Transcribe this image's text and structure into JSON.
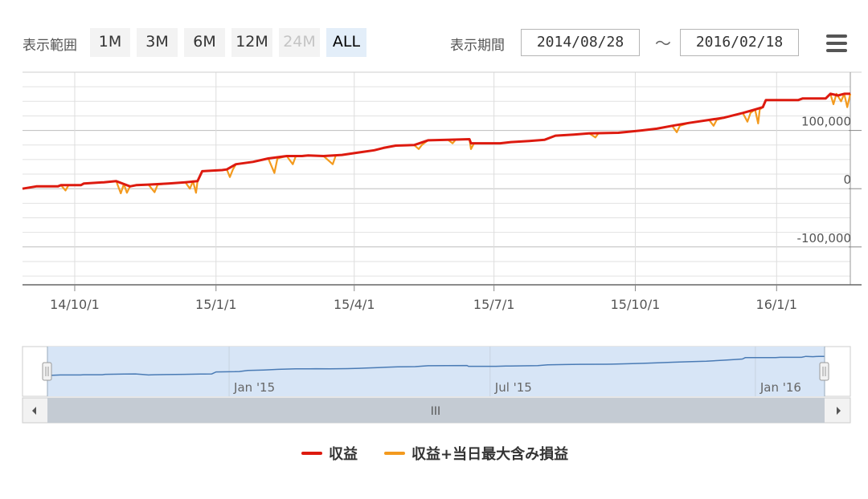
{
  "range_selector": {
    "label": "表示範囲",
    "buttons": [
      {
        "label": "1M",
        "state": "normal"
      },
      {
        "label": "3M",
        "state": "normal"
      },
      {
        "label": "6M",
        "state": "normal"
      },
      {
        "label": "12M",
        "state": "normal"
      },
      {
        "label": "24M",
        "state": "disabled"
      },
      {
        "label": "ALL",
        "state": "active"
      }
    ]
  },
  "period": {
    "label": "表示期間",
    "from": "2014/08/28",
    "separator": "〜",
    "to": "2016/02/18"
  },
  "menu_icon": "hamburger-menu-icon",
  "colors": {
    "profit_line": "#dd1a0f",
    "profit_max_line": "#f39a1e",
    "navigator_line": "#4a7bb5",
    "navigator_fill": "#d7e5f6",
    "grid": "#dddddd"
  },
  "chart_data": {
    "type": "line",
    "x_axis": {
      "type": "date",
      "range": [
        "2014-08-28",
        "2016-02-18"
      ],
      "tick_labels": [
        {
          "date": "2014-10-01",
          "label": "14/10/1"
        },
        {
          "date": "2015-01-01",
          "label": "15/1/1"
        },
        {
          "date": "2015-04-01",
          "label": "15/4/1"
        },
        {
          "date": "2015-07-01",
          "label": "15/7/1"
        },
        {
          "date": "2015-10-01",
          "label": "15/10/1"
        },
        {
          "date": "2016-01-01",
          "label": "16/1/1"
        }
      ]
    },
    "y_axis": {
      "range": [
        -165000,
        200000
      ],
      "position": "right",
      "tick_labels": [
        {
          "value": 100000,
          "label": "100,000"
        },
        {
          "value": 0,
          "label": "0"
        },
        {
          "value": -100000,
          "label": "-100,000"
        }
      ]
    },
    "grid": true,
    "legend_position": "bottom-center",
    "series": [
      {
        "name": "収益",
        "color": "#dd1a0f",
        "points": [
          [
            "2014-08-28",
            0
          ],
          [
            "2014-09-06",
            4000
          ],
          [
            "2014-09-20",
            4000
          ],
          [
            "2014-09-22",
            6000
          ],
          [
            "2014-10-05",
            6000
          ],
          [
            "2014-10-07",
            9000
          ],
          [
            "2014-10-20",
            11000
          ],
          [
            "2014-10-28",
            13000
          ],
          [
            "2014-11-02",
            8000
          ],
          [
            "2014-11-06",
            4000
          ],
          [
            "2014-11-10",
            6000
          ],
          [
            "2014-11-18",
            7000
          ],
          [
            "2014-12-01",
            9000
          ],
          [
            "2014-12-12",
            11000
          ],
          [
            "2014-12-20",
            13000
          ],
          [
            "2014-12-23",
            30000
          ],
          [
            "2015-01-05",
            32000
          ],
          [
            "2015-01-08",
            33000
          ],
          [
            "2015-01-14",
            42000
          ],
          [
            "2015-01-25",
            46000
          ],
          [
            "2015-02-04",
            52000
          ],
          [
            "2015-02-16",
            56000
          ],
          [
            "2015-02-26",
            56000
          ],
          [
            "2015-03-02",
            57000
          ],
          [
            "2015-03-12",
            56000
          ],
          [
            "2015-03-24",
            58000
          ],
          [
            "2015-04-01",
            61000
          ],
          [
            "2015-04-06",
            63000
          ],
          [
            "2015-04-14",
            66000
          ],
          [
            "2015-04-20",
            70000
          ],
          [
            "2015-04-28",
            74000
          ],
          [
            "2015-05-10",
            75000
          ],
          [
            "2015-05-19",
            83000
          ],
          [
            "2015-06-01",
            84000
          ],
          [
            "2015-06-15",
            85000
          ],
          [
            "2015-06-16",
            78000
          ],
          [
            "2015-07-05",
            78000
          ],
          [
            "2015-07-12",
            80000
          ],
          [
            "2015-07-24",
            82000
          ],
          [
            "2015-08-03",
            84000
          ],
          [
            "2015-08-10",
            91000
          ],
          [
            "2015-08-22",
            93000
          ],
          [
            "2015-09-01",
            95000
          ],
          [
            "2015-09-20",
            96000
          ],
          [
            "2015-10-05",
            100000
          ],
          [
            "2015-10-15",
            103000
          ],
          [
            "2015-10-25",
            108000
          ],
          [
            "2015-11-05",
            113000
          ],
          [
            "2015-11-18",
            118000
          ],
          [
            "2015-11-28",
            122000
          ],
          [
            "2015-12-10",
            130000
          ],
          [
            "2015-12-18",
            136000
          ],
          [
            "2015-12-23",
            140000
          ],
          [
            "2015-12-25",
            152000
          ],
          [
            "2016-01-15",
            152000
          ],
          [
            "2016-01-18",
            155000
          ],
          [
            "2016-02-02",
            155000
          ],
          [
            "2016-02-05",
            163000
          ],
          [
            "2016-02-10",
            160000
          ],
          [
            "2016-02-14",
            163000
          ],
          [
            "2016-02-18",
            163000
          ]
        ]
      },
      {
        "name": "収益+当日最大含み損益",
        "color": "#f39a1e",
        "points": [
          [
            "2014-08-28",
            0
          ],
          [
            "2014-09-06",
            4000
          ],
          [
            "2014-09-20",
            4000
          ],
          [
            "2014-09-22",
            6000
          ],
          [
            "2014-09-25",
            -3000
          ],
          [
            "2014-09-27",
            6000
          ],
          [
            "2014-10-05",
            6000
          ],
          [
            "2014-10-07",
            9000
          ],
          [
            "2014-10-20",
            11000
          ],
          [
            "2014-10-28",
            13000
          ],
          [
            "2014-10-31",
            -8000
          ],
          [
            "2014-11-02",
            8000
          ],
          [
            "2014-11-04",
            -7000
          ],
          [
            "2014-11-06",
            4000
          ],
          [
            "2014-11-10",
            6000
          ],
          [
            "2014-11-18",
            7000
          ],
          [
            "2014-11-22",
            -6000
          ],
          [
            "2014-11-24",
            7000
          ],
          [
            "2014-12-01",
            9000
          ],
          [
            "2014-12-12",
            11000
          ],
          [
            "2014-12-15",
            0
          ],
          [
            "2014-12-17",
            13000
          ],
          [
            "2014-12-19",
            -7000
          ],
          [
            "2014-12-20",
            13000
          ],
          [
            "2014-12-23",
            30000
          ],
          [
            "2015-01-05",
            32000
          ],
          [
            "2015-01-08",
            33000
          ],
          [
            "2015-01-10",
            20000
          ],
          [
            "2015-01-12",
            33000
          ],
          [
            "2015-01-14",
            42000
          ],
          [
            "2015-01-25",
            46000
          ],
          [
            "2015-02-04",
            52000
          ],
          [
            "2015-02-08",
            27000
          ],
          [
            "2015-02-10",
            52000
          ],
          [
            "2015-02-16",
            56000
          ],
          [
            "2015-02-20",
            42000
          ],
          [
            "2015-02-22",
            56000
          ],
          [
            "2015-03-02",
            57000
          ],
          [
            "2015-03-12",
            56000
          ],
          [
            "2015-03-18",
            42000
          ],
          [
            "2015-03-20",
            57000
          ],
          [
            "2015-03-24",
            58000
          ],
          [
            "2015-04-01",
            61000
          ],
          [
            "2015-04-06",
            63000
          ],
          [
            "2015-04-14",
            66000
          ],
          [
            "2015-04-20",
            70000
          ],
          [
            "2015-04-28",
            74000
          ],
          [
            "2015-05-10",
            75000
          ],
          [
            "2015-05-13",
            68000
          ],
          [
            "2015-05-15",
            75000
          ],
          [
            "2015-05-19",
            83000
          ],
          [
            "2015-06-01",
            84000
          ],
          [
            "2015-06-04",
            78000
          ],
          [
            "2015-06-06",
            84000
          ],
          [
            "2015-06-15",
            85000
          ],
          [
            "2015-06-16",
            68000
          ],
          [
            "2015-06-18",
            78000
          ],
          [
            "2015-07-05",
            78000
          ],
          [
            "2015-07-12",
            80000
          ],
          [
            "2015-07-24",
            82000
          ],
          [
            "2015-08-03",
            84000
          ],
          [
            "2015-08-10",
            91000
          ],
          [
            "2015-08-22",
            93000
          ],
          [
            "2015-09-01",
            95000
          ],
          [
            "2015-09-05",
            88000
          ],
          [
            "2015-09-07",
            95000
          ],
          [
            "2015-09-20",
            96000
          ],
          [
            "2015-10-05",
            100000
          ],
          [
            "2015-10-15",
            103000
          ],
          [
            "2015-10-25",
            108000
          ],
          [
            "2015-10-28",
            97000
          ],
          [
            "2015-10-30",
            108000
          ],
          [
            "2015-11-05",
            113000
          ],
          [
            "2015-11-18",
            118000
          ],
          [
            "2015-11-21",
            108000
          ],
          [
            "2015-11-23",
            118000
          ],
          [
            "2015-11-28",
            122000
          ],
          [
            "2015-12-10",
            130000
          ],
          [
            "2015-12-13",
            115000
          ],
          [
            "2015-12-15",
            130000
          ],
          [
            "2015-12-18",
            136000
          ],
          [
            "2015-12-20",
            112000
          ],
          [
            "2015-12-21",
            136000
          ],
          [
            "2015-12-23",
            140000
          ],
          [
            "2015-12-25",
            152000
          ],
          [
            "2016-01-15",
            152000
          ],
          [
            "2016-01-18",
            155000
          ],
          [
            "2016-02-02",
            155000
          ],
          [
            "2016-02-05",
            163000
          ],
          [
            "2016-02-07",
            145000
          ],
          [
            "2016-02-09",
            163000
          ],
          [
            "2016-02-12",
            150000
          ],
          [
            "2016-02-14",
            163000
          ],
          [
            "2016-02-16",
            140000
          ],
          [
            "2016-02-18",
            163000
          ]
        ]
      }
    ],
    "navigator": {
      "tick_labels": [
        {
          "date": "2015-01-01",
          "label": "Jan '15"
        },
        {
          "date": "2015-07-01",
          "label": "Jul '15"
        },
        {
          "date": "2016-01-01",
          "label": "Jan '16"
        }
      ],
      "scrollbar_grip": "III",
      "left_arrow_icon": "arrow-left-icon",
      "right_arrow_icon": "arrow-right-icon"
    }
  },
  "legend": {
    "items": [
      {
        "label": "収益",
        "color": "#dd1a0f"
      },
      {
        "label": "収益+当日最大含み損益",
        "color": "#f39a1e"
      }
    ]
  }
}
